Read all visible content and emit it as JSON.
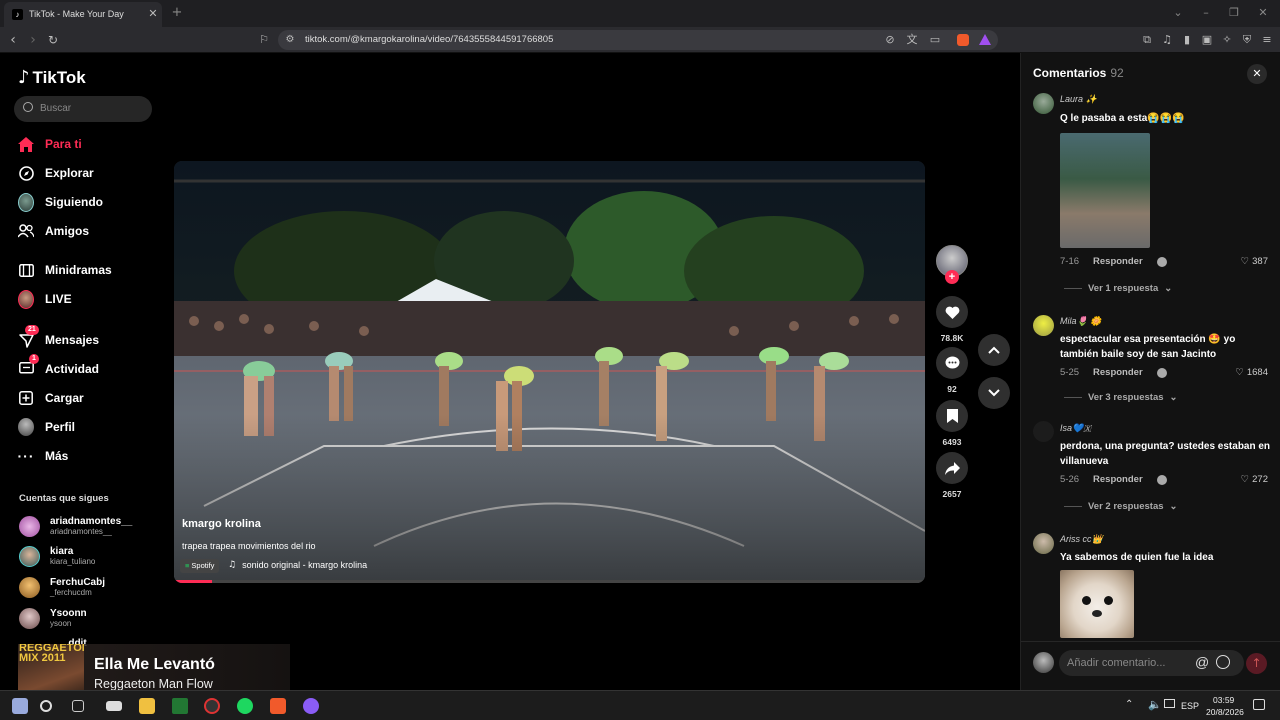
{
  "browser": {
    "tab_title": "TikTok - Make Your Day",
    "url": "tiktok.com/@kmargokarolina/video/7643555844591766805"
  },
  "sidebar": {
    "logo": "TikTok",
    "search_placeholder": "Buscar",
    "nav": [
      {
        "label": "Para ti",
        "active": true
      },
      {
        "label": "Explorar"
      },
      {
        "label": "Siguiendo"
      },
      {
        "label": "Amigos"
      },
      {
        "label": "Minidramas"
      },
      {
        "label": "LIVE"
      },
      {
        "label": "Mensajes",
        "badge": "21"
      },
      {
        "label": "Actividad",
        "badge": "1"
      },
      {
        "label": "Cargar"
      },
      {
        "label": "Perfil"
      },
      {
        "label": "Más"
      }
    ],
    "following_title": "Cuentas que sigues",
    "following": [
      {
        "name": "ariadnamontes__",
        "handle": "ariadnamontes__"
      },
      {
        "name": "kiara",
        "handle": "kiara_tuliano"
      },
      {
        "name": "FerchuCabj",
        "handle": "_ferchucdm"
      },
      {
        "name": "Ysoonn",
        "handle": "ysoon"
      },
      {
        "name": "...ddit",
        "handle": ""
      }
    ]
  },
  "video": {
    "author": "kmargo krolina",
    "caption": "trapea trapea movimientos del rio",
    "spotify_label": "Spotify",
    "sound": "sonido original - kmargo krolina",
    "progress": 0.05
  },
  "actions": {
    "likes": "78.8K",
    "comments": "92",
    "saves": "6493",
    "shares": "2657"
  },
  "comments_panel": {
    "title": "Comentarios",
    "count": "92",
    "reply_label": "Responder",
    "input_placeholder": "Añadir comentario...",
    "items": [
      {
        "user": "Laura ✨",
        "text": "Q le pasaba a esta😭😭😭",
        "date": "7-16",
        "likes": "387",
        "more": "Ver 1 respuesta"
      },
      {
        "user": "Mila🌷 🌼",
        "text": "espectacular esa presentación 🤩 yo también baile soy de san Jacinto",
        "date": "5-25",
        "likes": "1684",
        "more": "Ver 3 respuestas"
      },
      {
        "user": "Isa💙🇽",
        "text": "perdona, una pregunta? ustedes estaban en villanueva",
        "date": "5-26",
        "likes": "272",
        "more": "Ver 2 respuestas"
      },
      {
        "user": "Ariss cc👑",
        "text": "Ya sabemos de quien fue la idea",
        "date": "",
        "likes": "",
        "more": ""
      }
    ]
  },
  "media_overlay": {
    "album": "REGGAETON MIX 2011",
    "title": "Ella Me Levantó",
    "artist": "Reggaeton Man Flow"
  },
  "taskbar": {
    "lang": "ESP",
    "time": "03:59",
    "date": "20/8/2026"
  },
  "colors": {
    "accent": "#fe2c55",
    "bg": "#000000",
    "panel": "#121212"
  }
}
